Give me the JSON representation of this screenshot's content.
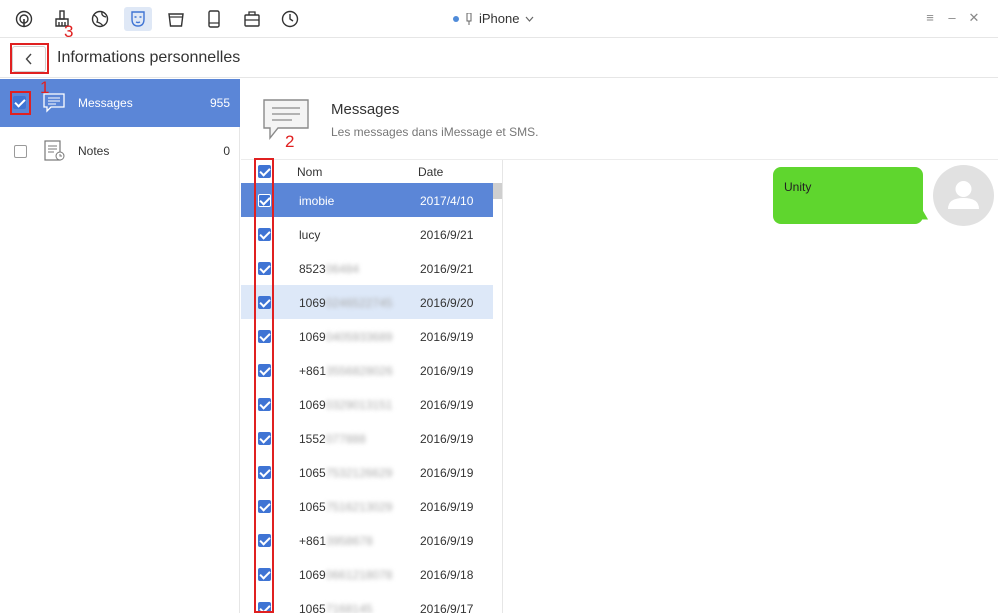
{
  "toolbar": {
    "tools": [
      {
        "icon": "airbackup-icon"
      },
      {
        "icon": "cleaner-icon"
      },
      {
        "icon": "globe-icon"
      },
      {
        "icon": "mask-icon",
        "active": true
      },
      {
        "icon": "trash-bin-icon"
      },
      {
        "icon": "phone-icon"
      },
      {
        "icon": "toolbox-icon"
      },
      {
        "icon": "history-icon"
      }
    ],
    "device_name": "iPhone"
  },
  "window_controls": {
    "menu": "≡",
    "minimize": "–",
    "close": "✕"
  },
  "header": {
    "title": "Informations personnelles"
  },
  "sidebar": {
    "items": [
      {
        "label": "Messages",
        "count": "955",
        "checked": true,
        "selected": true
      },
      {
        "label": "Notes",
        "count": "0",
        "checked": false,
        "selected": false
      }
    ]
  },
  "content": {
    "title": "Messages",
    "subtitle": "Les messages dans iMessage et SMS."
  },
  "list": {
    "columns": {
      "name": "Nom",
      "date": "Date"
    },
    "rows": [
      {
        "name": "imobie",
        "hidden": "",
        "date": "2017/4/10"
      },
      {
        "name": "lucy",
        "hidden": "",
        "date": "2016/9/21"
      },
      {
        "name": "8523",
        "hidden": "06484",
        "date": "2016/9/21"
      },
      {
        "name": "1069",
        "hidden": "0246522745",
        "date": "2016/9/20"
      },
      {
        "name": "1069",
        "hidden": "0405933689",
        "date": "2016/9/19"
      },
      {
        "name": "+861",
        "hidden": "3556828026",
        "date": "2016/9/19"
      },
      {
        "name": "1069",
        "hidden": "0329013151",
        "date": "2016/9/19"
      },
      {
        "name": "1552",
        "hidden": "077888",
        "date": "2016/9/19"
      },
      {
        "name": "1065",
        "hidden": "7532126629",
        "date": "2016/9/19"
      },
      {
        "name": "1065",
        "hidden": "7516213029",
        "date": "2016/9/19"
      },
      {
        "name": "+861",
        "hidden": "3958678",
        "date": "2016/9/19"
      },
      {
        "name": "1069",
        "hidden": "0661218078",
        "date": "2016/9/18"
      },
      {
        "name": "1065",
        "hidden": "7168145",
        "date": "2016/9/17"
      }
    ]
  },
  "chat": {
    "bubble_text": "Unity"
  },
  "annotations": {
    "n1": "1",
    "n2": "2",
    "n3": "3"
  },
  "colors": {
    "accent": "#5b86d7",
    "bubble": "#5fd62e",
    "annotation": "#e02020"
  }
}
